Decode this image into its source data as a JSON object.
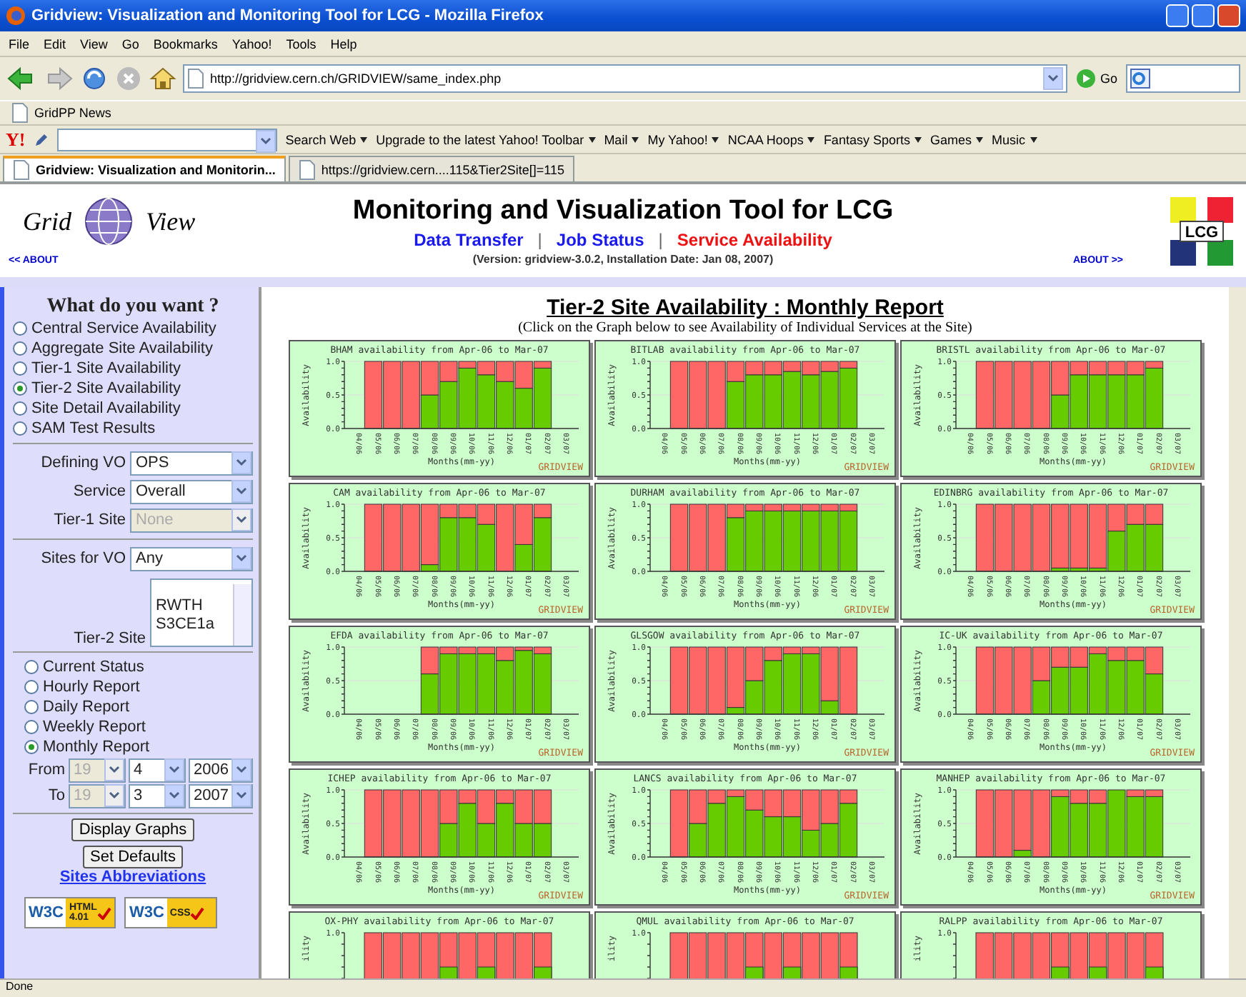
{
  "window": {
    "title": "Gridview: Visualization and Monitoring Tool for LCG - Mozilla Firefox"
  },
  "menu": [
    "File",
    "Edit",
    "View",
    "Go",
    "Bookmarks",
    "Yahoo!",
    "Tools",
    "Help"
  ],
  "address_bar": {
    "url": "http://gridview.cern.ch/GRIDVIEW/same_index.php"
  },
  "go_button": "Go",
  "bookmarks": [
    "GridPP News"
  ],
  "yahoo_toolbar": {
    "logo": "Y!",
    "items": [
      "Search Web",
      "Upgrade to the latest Yahoo! Toolbar",
      "Mail",
      "My Yahoo!",
      "NCAA Hoops",
      "Fantasy Sports",
      "Games",
      "Music"
    ]
  },
  "tabs": [
    {
      "label": "Gridview: Visualization and Monitorin...",
      "selected": true
    },
    {
      "label": "https://gridview.cern....115&Tier2Site[]=115",
      "selected": false
    }
  ],
  "header": {
    "logo_words": [
      "Grid",
      "View"
    ],
    "title": "Monitoring and Visualization Tool for LCG",
    "links": [
      {
        "label": "Data Transfer",
        "selected": false
      },
      {
        "label": "Job Status",
        "selected": false
      },
      {
        "label": "Service Availability",
        "selected": true
      }
    ],
    "separators": [
      "|",
      "|"
    ],
    "version": "(Version: gridview-3.0.2, Installation Date: Jan 08, 2007)",
    "about_left": "<< ABOUT",
    "about_right": "ABOUT >>",
    "lcg_logo": "LCG"
  },
  "sidebar": {
    "heading": "What do you want ?",
    "views": [
      {
        "label": "Central Service Availability",
        "selected": false
      },
      {
        "label": "Aggregate Site Availability",
        "selected": false
      },
      {
        "label": "Tier-1 Site Availability",
        "selected": false
      },
      {
        "label": "Tier-2 Site Availability",
        "selected": true
      },
      {
        "label": "Site Detail Availability",
        "selected": false
      },
      {
        "label": "SAM Test Results",
        "selected": false
      }
    ],
    "selects": [
      {
        "label": "Defining VO",
        "value": "OPS",
        "disabled": false
      },
      {
        "label": "Service",
        "value": "Overall",
        "disabled": false
      },
      {
        "label": "Tier-1 Site",
        "value": "None",
        "disabled": true
      }
    ],
    "sites_for_vo": {
      "label": "Sites for VO",
      "value": "Any"
    },
    "tier2_site": {
      "label": "Tier-2 Site",
      "options": [
        "RWTH",
        "S3CE1a"
      ]
    },
    "reports": [
      {
        "label": "Current Status",
        "selected": false
      },
      {
        "label": "Hourly Report",
        "selected": false
      },
      {
        "label": "Daily Report",
        "selected": false
      },
      {
        "label": "Weekly Report",
        "selected": false
      },
      {
        "label": "Monthly Report",
        "selected": true
      }
    ],
    "ranges": [
      {
        "label": "From",
        "day": "19",
        "month": "4",
        "year": "2006"
      },
      {
        "label": "To",
        "day": "19",
        "month": "3",
        "year": "2007"
      }
    ],
    "buttons": [
      "Display Graphs",
      "Set Defaults"
    ],
    "link": "Sites Abbreviations",
    "badges": [
      {
        "w3c": "W3C",
        "text": "HTML 4.01"
      },
      {
        "w3c": "W3C",
        "text": "CSS"
      }
    ]
  },
  "content": {
    "title": "Tier-2 Site Availability : Monthly Report",
    "subtitle": "(Click on the Graph below to see Availability of Individual Services at the Site)",
    "graphs": [
      {
        "brand": "GRIDVIEW",
        "chart_data": {
          "type": "bar",
          "title": "BHAM availability from Apr-06 to Mar-07",
          "xlabel": "Months(mm-yy)",
          "ylabel": "Availability",
          "categories": [
            "04/06",
            "05/06",
            "06/06",
            "07/06",
            "08/06",
            "09/06",
            "10/06",
            "11/06",
            "12/06",
            "01/07",
            "02/07",
            "03/07"
          ],
          "stacked": true,
          "ylim": [
            0,
            1
          ],
          "yticks": [
            {
              "value": 0,
              "label": "0.0"
            },
            {
              "value": 0.5,
              "label": "0.5"
            },
            {
              "value": 1,
              "label": "1.0"
            }
          ],
          "series": [
            {
              "color": "#66cc00",
              "values": [
                null,
                0,
                0,
                0,
                0.5,
                0.7,
                0.9,
                0.8,
                0.7,
                0.6,
                0.9,
                null
              ]
            },
            {
              "color": "#ff6666",
              "values": [
                null,
                1,
                1,
                1,
                0.5,
                0.3,
                0.1,
                0.2,
                0.3,
                0.4,
                0.1,
                null
              ]
            }
          ]
        }
      },
      {
        "brand": "GRIDVIEW",
        "chart_data": {
          "type": "bar",
          "title": "BITLAB availability from Apr-06 to Mar-07",
          "xlabel": "Months(mm-yy)",
          "ylabel": "Availability",
          "categories": [
            "04/06",
            "05/06",
            "06/06",
            "07/06",
            "08/06",
            "09/06",
            "10/06",
            "11/06",
            "12/06",
            "01/07",
            "02/07",
            "03/07"
          ],
          "stacked": true,
          "ylim": [
            0,
            1
          ],
          "yticks": [
            {
              "value": 0,
              "label": "0.0"
            },
            {
              "value": 0.5,
              "label": "0.5"
            },
            {
              "value": 1,
              "label": "1.0"
            }
          ],
          "series": [
            {
              "color": "#66cc00",
              "values": [
                null,
                0,
                0,
                0,
                0.7,
                0.8,
                0.8,
                0.85,
                0.8,
                0.85,
                0.9,
                null
              ]
            },
            {
              "color": "#ff6666",
              "values": [
                null,
                1,
                1,
                1,
                0.3,
                0.2,
                0.2,
                0.15,
                0.2,
                0.15,
                0.1,
                null
              ]
            }
          ]
        }
      },
      {
        "brand": "GRIDVIEW",
        "chart_data": {
          "type": "bar",
          "title": "BRISTL availability from Apr-06 to Mar-07",
          "xlabel": "Months(mm-yy)",
          "ylabel": "Availability",
          "categories": [
            "04/06",
            "05/06",
            "06/06",
            "07/06",
            "08/06",
            "09/06",
            "10/06",
            "11/06",
            "12/06",
            "01/07",
            "02/07",
            "03/07"
          ],
          "stacked": true,
          "ylim": [
            0,
            1
          ],
          "yticks": [
            {
              "value": 0,
              "label": "0.0"
            },
            {
              "value": 0.5,
              "label": "0.5"
            },
            {
              "value": 1,
              "label": "1.0"
            }
          ],
          "series": [
            {
              "color": "#66cc00",
              "values": [
                null,
                0,
                0,
                0,
                0,
                0.5,
                0.8,
                0.8,
                0.8,
                0.8,
                0.9,
                null
              ]
            },
            {
              "color": "#ff6666",
              "values": [
                null,
                1,
                1,
                1,
                1,
                0.5,
                0.2,
                0.2,
                0.2,
                0.2,
                0.1,
                null
              ]
            }
          ]
        }
      },
      {
        "brand": "GRIDVIEW",
        "chart_data": {
          "type": "bar",
          "title": "CAM availability from Apr-06 to Mar-07",
          "xlabel": "Months(mm-yy)",
          "ylabel": "Availability",
          "categories": [
            "04/06",
            "05/06",
            "06/06",
            "07/06",
            "08/06",
            "09/06",
            "10/06",
            "11/06",
            "12/06",
            "01/07",
            "02/07",
            "03/07"
          ],
          "stacked": true,
          "ylim": [
            0,
            1
          ],
          "yticks": [
            {
              "value": 0,
              "label": "0.0"
            },
            {
              "value": 0.5,
              "label": "0.5"
            },
            {
              "value": 1,
              "label": "1.0"
            }
          ],
          "series": [
            {
              "color": "#66cc00",
              "values": [
                null,
                0,
                0,
                0,
                0.1,
                0.8,
                0.8,
                0.7,
                0,
                0.4,
                0.8,
                null
              ]
            },
            {
              "color": "#ff6666",
              "values": [
                null,
                1,
                1,
                1,
                0.9,
                0.2,
                0.2,
                0.3,
                1,
                0.6,
                0.2,
                null
              ]
            }
          ]
        }
      },
      {
        "brand": "GRIDVIEW",
        "chart_data": {
          "type": "bar",
          "title": "DURHAM availability from Apr-06 to Mar-07",
          "xlabel": "Months(mm-yy)",
          "ylabel": "Availability",
          "categories": [
            "04/06",
            "05/06",
            "06/06",
            "07/06",
            "08/06",
            "09/06",
            "10/06",
            "11/06",
            "12/06",
            "01/07",
            "02/07",
            "03/07"
          ],
          "stacked": true,
          "ylim": [
            0,
            1
          ],
          "yticks": [
            {
              "value": 0,
              "label": "0.0"
            },
            {
              "value": 0.5,
              "label": "0.5"
            },
            {
              "value": 1,
              "label": "1.0"
            }
          ],
          "series": [
            {
              "color": "#66cc00",
              "values": [
                null,
                0,
                0,
                0,
                0.8,
                0.9,
                0.9,
                0.9,
                0.9,
                0.9,
                0.9,
                null
              ]
            },
            {
              "color": "#ff6666",
              "values": [
                null,
                1,
                1,
                1,
                0.2,
                0.1,
                0.1,
                0.1,
                0.1,
                0.1,
                0.1,
                null
              ]
            }
          ]
        }
      },
      {
        "brand": "GRIDVIEW",
        "chart_data": {
          "type": "bar",
          "title": "EDINBRG availability from Apr-06 to Mar-07",
          "xlabel": "Months(mm-yy)",
          "ylabel": "Availability",
          "categories": [
            "04/06",
            "05/06",
            "06/06",
            "07/06",
            "08/06",
            "09/06",
            "10/06",
            "11/06",
            "12/06",
            "01/07",
            "02/07",
            "03/07"
          ],
          "stacked": true,
          "ylim": [
            0,
            1
          ],
          "yticks": [
            {
              "value": 0,
              "label": "0.0"
            },
            {
              "value": 0.5,
              "label": "0.5"
            },
            {
              "value": 1,
              "label": "1.0"
            }
          ],
          "series": [
            {
              "color": "#66cc00",
              "values": [
                null,
                0,
                0,
                0,
                0,
                0.05,
                0.05,
                0.05,
                0.6,
                0.7,
                0.7,
                null
              ]
            },
            {
              "color": "#ff6666",
              "values": [
                null,
                1,
                1,
                1,
                1,
                0.95,
                0.95,
                0.95,
                0.4,
                0.3,
                0.3,
                null
              ]
            }
          ]
        }
      },
      {
        "brand": "GRIDVIEW",
        "chart_data": {
          "type": "bar",
          "title": "EFDA availability from Apr-06 to Mar-07",
          "xlabel": "Months(mm-yy)",
          "ylabel": "Availability",
          "categories": [
            "04/06",
            "05/06",
            "06/06",
            "07/06",
            "08/06",
            "09/06",
            "10/06",
            "11/06",
            "12/06",
            "01/07",
            "02/07",
            "03/07"
          ],
          "stacked": true,
          "ylim": [
            0,
            1
          ],
          "yticks": [
            {
              "value": 0,
              "label": "0.0"
            },
            {
              "value": 0.5,
              "label": "0.5"
            },
            {
              "value": 1,
              "label": "1.0"
            }
          ],
          "series": [
            {
              "color": "#66cc00",
              "values": [
                null,
                null,
                null,
                null,
                0.6,
                0.9,
                0.9,
                0.9,
                0.8,
                0.95,
                0.9,
                null
              ]
            },
            {
              "color": "#ff6666",
              "values": [
                null,
                null,
                null,
                null,
                0.4,
                0.1,
                0.1,
                0.1,
                0.2,
                0.05,
                0.1,
                null
              ]
            }
          ]
        }
      },
      {
        "brand": "GRIDVIEW",
        "chart_data": {
          "type": "bar",
          "title": "GLSGOW availability from Apr-06 to Mar-07",
          "xlabel": "Months(mm-yy)",
          "ylabel": "Availability",
          "categories": [
            "04/06",
            "05/06",
            "06/06",
            "07/06",
            "08/06",
            "09/06",
            "10/06",
            "11/06",
            "12/06",
            "01/07",
            "02/07",
            "03/07"
          ],
          "stacked": true,
          "ylim": [
            0,
            1
          ],
          "yticks": [
            {
              "value": 0,
              "label": "0.0"
            },
            {
              "value": 0.5,
              "label": "0.5"
            },
            {
              "value": 1,
              "label": "1.0"
            }
          ],
          "series": [
            {
              "color": "#66cc00",
              "values": [
                null,
                0,
                0,
                0,
                0.1,
                0.5,
                0.8,
                0.9,
                0.9,
                0.2,
                0,
                null
              ]
            },
            {
              "color": "#ff6666",
              "values": [
                null,
                1,
                1,
                1,
                0.9,
                0.5,
                0.2,
                0.1,
                0.1,
                0.8,
                1,
                null
              ]
            }
          ]
        }
      },
      {
        "brand": "GRIDVIEW",
        "chart_data": {
          "type": "bar",
          "title": "IC-UK availability from Apr-06 to Mar-07",
          "xlabel": "Months(mm-yy)",
          "ylabel": "Availability",
          "categories": [
            "04/06",
            "05/06",
            "06/06",
            "07/06",
            "08/06",
            "09/06",
            "10/06",
            "11/06",
            "12/06",
            "01/07",
            "02/07",
            "03/07"
          ],
          "stacked": true,
          "ylim": [
            0,
            1
          ],
          "yticks": [
            {
              "value": 0,
              "label": "0.0"
            },
            {
              "value": 0.5,
              "label": "0.5"
            },
            {
              "value": 1,
              "label": "1.0"
            }
          ],
          "series": [
            {
              "color": "#66cc00",
              "values": [
                null,
                0,
                0,
                0,
                0.5,
                0.7,
                0.7,
                0.9,
                0.8,
                0.8,
                0.6,
                null
              ]
            },
            {
              "color": "#ff6666",
              "values": [
                null,
                1,
                1,
                1,
                0.5,
                0.3,
                0.3,
                0.1,
                0.2,
                0.2,
                0.4,
                null
              ]
            }
          ]
        }
      },
      {
        "brand": "GRIDVIEW",
        "chart_data": {
          "type": "bar",
          "title": "ICHEP availability from Apr-06 to Mar-07",
          "xlabel": "Months(mm-yy)",
          "ylabel": "Availability",
          "categories": [
            "04/06",
            "05/06",
            "06/06",
            "07/06",
            "08/06",
            "09/06",
            "10/06",
            "11/06",
            "12/06",
            "01/07",
            "02/07",
            "03/07"
          ],
          "stacked": true,
          "ylim": [
            0,
            1
          ],
          "yticks": [
            {
              "value": 0,
              "label": "0.0"
            },
            {
              "value": 0.5,
              "label": "0.5"
            },
            {
              "value": 1,
              "label": "1.0"
            }
          ],
          "series": [
            {
              "color": "#66cc00",
              "values": [
                null,
                0,
                0,
                0,
                0,
                0.5,
                0.8,
                0.5,
                0.8,
                0.5,
                0.5,
                null
              ]
            },
            {
              "color": "#ff6666",
              "values": [
                null,
                1,
                1,
                1,
                1,
                0.5,
                0.2,
                0.5,
                0.2,
                0.5,
                0.5,
                null
              ]
            }
          ]
        }
      },
      {
        "brand": "GRIDVIEW",
        "chart_data": {
          "type": "bar",
          "title": "LANCS availability from Apr-06 to Mar-07",
          "xlabel": "Months(mm-yy)",
          "ylabel": "Availability",
          "categories": [
            "04/06",
            "05/06",
            "06/06",
            "07/06",
            "08/06",
            "09/06",
            "10/06",
            "11/06",
            "12/06",
            "01/07",
            "02/07",
            "03/07"
          ],
          "stacked": true,
          "ylim": [
            0,
            1
          ],
          "yticks": [
            {
              "value": 0,
              "label": "0.0"
            },
            {
              "value": 0.5,
              "label": "0.5"
            },
            {
              "value": 1,
              "label": "1.0"
            }
          ],
          "series": [
            {
              "color": "#66cc00",
              "values": [
                null,
                0,
                0.5,
                0.8,
                0.9,
                0.7,
                0.6,
                0.6,
                0.4,
                0.5,
                0.8,
                null
              ]
            },
            {
              "color": "#ff6666",
              "values": [
                null,
                1,
                0.5,
                0.2,
                0.1,
                0.3,
                0.4,
                0.4,
                0.6,
                0.5,
                0.2,
                null
              ]
            }
          ]
        }
      },
      {
        "brand": "GRIDVIEW",
        "chart_data": {
          "type": "bar",
          "title": "MANHEP availability from Apr-06 to Mar-07",
          "xlabel": "Months(mm-yy)",
          "ylabel": "Availability",
          "categories": [
            "04/06",
            "05/06",
            "06/06",
            "07/06",
            "08/06",
            "09/06",
            "10/06",
            "11/06",
            "12/06",
            "01/07",
            "02/07",
            "03/07"
          ],
          "stacked": true,
          "ylim": [
            0,
            1
          ],
          "yticks": [
            {
              "value": 0,
              "label": "0.0"
            },
            {
              "value": 0.5,
              "label": "0.5"
            },
            {
              "value": 1,
              "label": "1.0"
            }
          ],
          "series": [
            {
              "color": "#66cc00",
              "values": [
                null,
                0,
                0,
                0.1,
                0,
                0.9,
                0.8,
                0.8,
                1,
                0.9,
                0.9,
                null
              ]
            },
            {
              "color": "#ff6666",
              "values": [
                null,
                1,
                1,
                0.9,
                1,
                0.1,
                0.2,
                0.2,
                0,
                0.1,
                0.1,
                null
              ]
            }
          ]
        }
      },
      {
        "title": "OX-PHY availability from Apr-06 to Mar-07",
        "ylabel": "ility",
        "tick": "1.0"
      },
      {
        "title": "QMUL availability from Apr-06 to Mar-07",
        "ylabel": "ility",
        "tick": "1.0"
      },
      {
        "title": "RALPP availability from Apr-06 to Mar-07",
        "ylabel": "ility",
        "tick": "1.0"
      }
    ]
  },
  "status_bar": "Done"
}
